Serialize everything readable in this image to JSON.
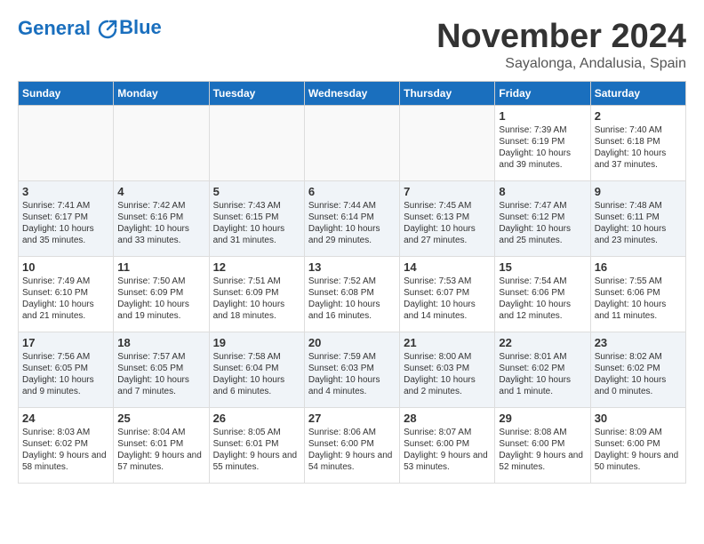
{
  "header": {
    "logo_line1": "General",
    "logo_line2": "Blue",
    "month": "November 2024",
    "location": "Sayalonga, Andalusia, Spain"
  },
  "days_of_week": [
    "Sunday",
    "Monday",
    "Tuesday",
    "Wednesday",
    "Thursday",
    "Friday",
    "Saturday"
  ],
  "weeks": [
    [
      {
        "day": "",
        "content": ""
      },
      {
        "day": "",
        "content": ""
      },
      {
        "day": "",
        "content": ""
      },
      {
        "day": "",
        "content": ""
      },
      {
        "day": "",
        "content": ""
      },
      {
        "day": "1",
        "content": "Sunrise: 7:39 AM\nSunset: 6:19 PM\nDaylight: 10 hours and 39 minutes."
      },
      {
        "day": "2",
        "content": "Sunrise: 7:40 AM\nSunset: 6:18 PM\nDaylight: 10 hours and 37 minutes."
      }
    ],
    [
      {
        "day": "3",
        "content": "Sunrise: 7:41 AM\nSunset: 6:17 PM\nDaylight: 10 hours and 35 minutes."
      },
      {
        "day": "4",
        "content": "Sunrise: 7:42 AM\nSunset: 6:16 PM\nDaylight: 10 hours and 33 minutes."
      },
      {
        "day": "5",
        "content": "Sunrise: 7:43 AM\nSunset: 6:15 PM\nDaylight: 10 hours and 31 minutes."
      },
      {
        "day": "6",
        "content": "Sunrise: 7:44 AM\nSunset: 6:14 PM\nDaylight: 10 hours and 29 minutes."
      },
      {
        "day": "7",
        "content": "Sunrise: 7:45 AM\nSunset: 6:13 PM\nDaylight: 10 hours and 27 minutes."
      },
      {
        "day": "8",
        "content": "Sunrise: 7:47 AM\nSunset: 6:12 PM\nDaylight: 10 hours and 25 minutes."
      },
      {
        "day": "9",
        "content": "Sunrise: 7:48 AM\nSunset: 6:11 PM\nDaylight: 10 hours and 23 minutes."
      }
    ],
    [
      {
        "day": "10",
        "content": "Sunrise: 7:49 AM\nSunset: 6:10 PM\nDaylight: 10 hours and 21 minutes."
      },
      {
        "day": "11",
        "content": "Sunrise: 7:50 AM\nSunset: 6:09 PM\nDaylight: 10 hours and 19 minutes."
      },
      {
        "day": "12",
        "content": "Sunrise: 7:51 AM\nSunset: 6:09 PM\nDaylight: 10 hours and 18 minutes."
      },
      {
        "day": "13",
        "content": "Sunrise: 7:52 AM\nSunset: 6:08 PM\nDaylight: 10 hours and 16 minutes."
      },
      {
        "day": "14",
        "content": "Sunrise: 7:53 AM\nSunset: 6:07 PM\nDaylight: 10 hours and 14 minutes."
      },
      {
        "day": "15",
        "content": "Sunrise: 7:54 AM\nSunset: 6:06 PM\nDaylight: 10 hours and 12 minutes."
      },
      {
        "day": "16",
        "content": "Sunrise: 7:55 AM\nSunset: 6:06 PM\nDaylight: 10 hours and 11 minutes."
      }
    ],
    [
      {
        "day": "17",
        "content": "Sunrise: 7:56 AM\nSunset: 6:05 PM\nDaylight: 10 hours and 9 minutes."
      },
      {
        "day": "18",
        "content": "Sunrise: 7:57 AM\nSunset: 6:05 PM\nDaylight: 10 hours and 7 minutes."
      },
      {
        "day": "19",
        "content": "Sunrise: 7:58 AM\nSunset: 6:04 PM\nDaylight: 10 hours and 6 minutes."
      },
      {
        "day": "20",
        "content": "Sunrise: 7:59 AM\nSunset: 6:03 PM\nDaylight: 10 hours and 4 minutes."
      },
      {
        "day": "21",
        "content": "Sunrise: 8:00 AM\nSunset: 6:03 PM\nDaylight: 10 hours and 2 minutes."
      },
      {
        "day": "22",
        "content": "Sunrise: 8:01 AM\nSunset: 6:02 PM\nDaylight: 10 hours and 1 minute."
      },
      {
        "day": "23",
        "content": "Sunrise: 8:02 AM\nSunset: 6:02 PM\nDaylight: 10 hours and 0 minutes."
      }
    ],
    [
      {
        "day": "24",
        "content": "Sunrise: 8:03 AM\nSunset: 6:02 PM\nDaylight: 9 hours and 58 minutes."
      },
      {
        "day": "25",
        "content": "Sunrise: 8:04 AM\nSunset: 6:01 PM\nDaylight: 9 hours and 57 minutes."
      },
      {
        "day": "26",
        "content": "Sunrise: 8:05 AM\nSunset: 6:01 PM\nDaylight: 9 hours and 55 minutes."
      },
      {
        "day": "27",
        "content": "Sunrise: 8:06 AM\nSunset: 6:00 PM\nDaylight: 9 hours and 54 minutes."
      },
      {
        "day": "28",
        "content": "Sunrise: 8:07 AM\nSunset: 6:00 PM\nDaylight: 9 hours and 53 minutes."
      },
      {
        "day": "29",
        "content": "Sunrise: 8:08 AM\nSunset: 6:00 PM\nDaylight: 9 hours and 52 minutes."
      },
      {
        "day": "30",
        "content": "Sunrise: 8:09 AM\nSunset: 6:00 PM\nDaylight: 9 hours and 50 minutes."
      }
    ]
  ]
}
